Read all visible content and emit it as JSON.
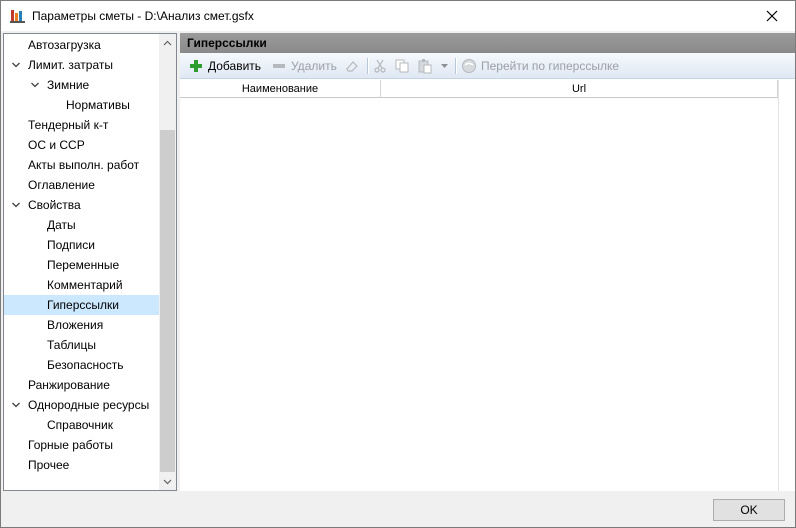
{
  "window": {
    "title": "Параметры сметы - D:\\Анализ смет.gsfx"
  },
  "tree": {
    "items": [
      {
        "label": "Автозагрузка",
        "level": 0,
        "expander": "none"
      },
      {
        "label": "Лимит. затраты",
        "level": 0,
        "expander": "expanded"
      },
      {
        "label": "Зимние",
        "level": 1,
        "expander": "expanded"
      },
      {
        "label": "Нормативы",
        "level": 2,
        "expander": "none"
      },
      {
        "label": "Тендерный к-т",
        "level": 0,
        "expander": "none"
      },
      {
        "label": "ОС и ССР",
        "level": 0,
        "expander": "none"
      },
      {
        "label": "Акты выполн. работ",
        "level": 0,
        "expander": "none"
      },
      {
        "label": "Оглавление",
        "level": 0,
        "expander": "none"
      },
      {
        "label": "Свойства",
        "level": 0,
        "expander": "expanded"
      },
      {
        "label": "Даты",
        "level": 1,
        "expander": "none"
      },
      {
        "label": "Подписи",
        "level": 1,
        "expander": "none"
      },
      {
        "label": "Переменные",
        "level": 1,
        "expander": "none"
      },
      {
        "label": "Комментарий",
        "level": 1,
        "expander": "none"
      },
      {
        "label": "Гиперссылки",
        "level": 1,
        "expander": "none",
        "selected": true
      },
      {
        "label": "Вложения",
        "level": 1,
        "expander": "none"
      },
      {
        "label": "Таблицы",
        "level": 1,
        "expander": "none"
      },
      {
        "label": "Безопасность",
        "level": 1,
        "expander": "none"
      },
      {
        "label": "Ранжирование",
        "level": 0,
        "expander": "none"
      },
      {
        "label": "Однородные ресурсы",
        "level": 0,
        "expander": "expanded"
      },
      {
        "label": "Справочник",
        "level": 1,
        "expander": "none"
      },
      {
        "label": "Горные работы",
        "level": 0,
        "expander": "none"
      },
      {
        "label": "Прочее",
        "level": 0,
        "expander": "none"
      }
    ]
  },
  "panel": {
    "header": "Гиперссылки",
    "toolbar": {
      "add_label": "Добавить",
      "delete_label": "Удалить",
      "goto_label": "Перейти по гиперссылке"
    },
    "grid": {
      "columns": [
        "Наименование",
        "Url"
      ]
    }
  },
  "footer": {
    "ok_label": "OK"
  },
  "colors": {
    "selection": "#cce8ff",
    "header_bg": "#8f8f8f",
    "add_icon": "#2e9d2e"
  }
}
